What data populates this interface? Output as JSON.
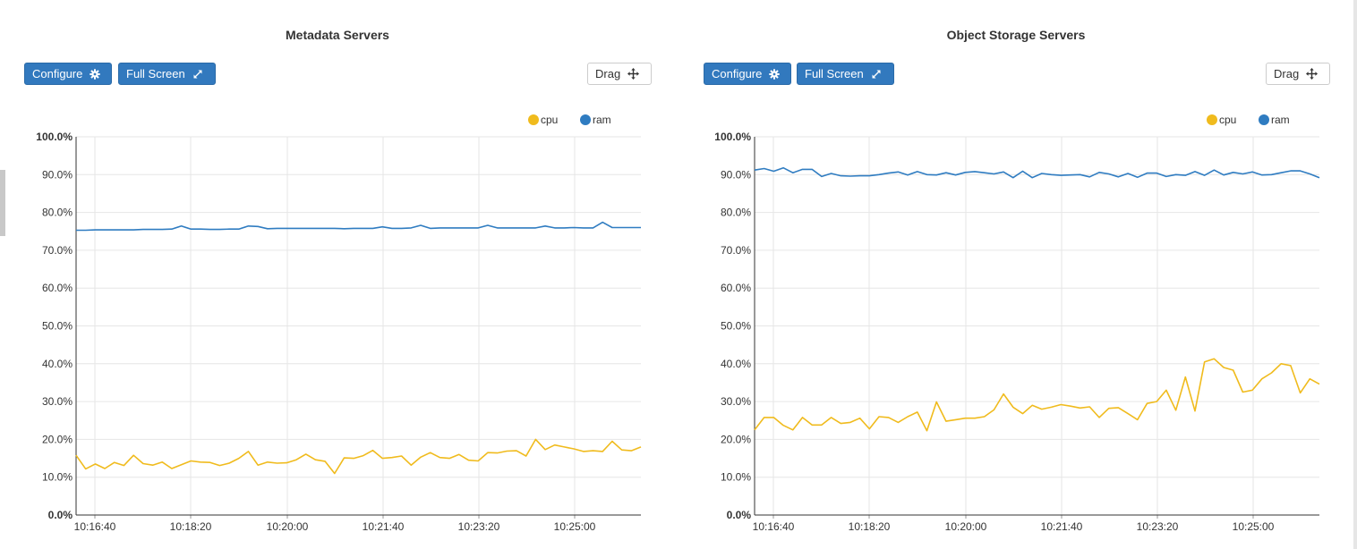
{
  "panels": [
    {
      "title": "Metadata Servers",
      "configure_label": "Configure",
      "fullscreen_label": "Full Screen",
      "drag_label": "Drag"
    },
    {
      "title": "Object Storage Servers",
      "configure_label": "Configure",
      "fullscreen_label": "Full Screen",
      "drag_label": "Drag"
    }
  ],
  "colors": {
    "cpu": "#f0bb1d",
    "ram": "#2f7cc1",
    "button": "#3279be"
  },
  "icons": {
    "configure": "gear-icon",
    "fullscreen": "expand-icon",
    "drag": "move-icon"
  },
  "chart_data": [
    {
      "type": "line",
      "title": "Metadata Servers",
      "x_ticks": [
        "10:16:40",
        "10:18:20",
        "10:20:00",
        "10:21:40",
        "10:23:20",
        "10:25:00"
      ],
      "y_ticks": [
        "0.0%",
        "10.0%",
        "20.0%",
        "30.0%",
        "40.0%",
        "50.0%",
        "60.0%",
        "70.0%",
        "80.0%",
        "90.0%",
        "100.0%"
      ],
      "ylim": [
        0,
        100
      ],
      "grid": true,
      "legend_position": "top-right",
      "series": [
        {
          "name": "cpu",
          "color": "#f0bb1d",
          "values": [
            15.8,
            12.2,
            13.5,
            12.3,
            13.9,
            13.1,
            15.8,
            13.6,
            13.2,
            14,
            12.3,
            13.3,
            14.3,
            14,
            13.9,
            13.1,
            13.7,
            15,
            16.8,
            13.2,
            14,
            13.7,
            13.8,
            14.6,
            16.1,
            14.6,
            14.2,
            11,
            15.1,
            15,
            15.7,
            17.1,
            15,
            15.2,
            15.6,
            13.2,
            15.3,
            16.5,
            15.2,
            15,
            16,
            14.5,
            14.3,
            16.5,
            16.4,
            16.9,
            17,
            15.6,
            20,
            17.3,
            18.5,
            18,
            17.5,
            16.8,
            17,
            16.8,
            19.5,
            17.2,
            17,
            18
          ]
        },
        {
          "name": "ram",
          "color": "#2f7cc1",
          "values": [
            75.3,
            75.3,
            75.4,
            75.4,
            75.4,
            75.4,
            75.4,
            75.5,
            75.5,
            75.5,
            75.6,
            76.4,
            75.6,
            75.6,
            75.5,
            75.5,
            75.6,
            75.6,
            76.4,
            76.3,
            75.7,
            75.8,
            75.8,
            75.8,
            75.8,
            75.8,
            75.8,
            75.8,
            75.7,
            75.8,
            75.8,
            75.8,
            76.2,
            75.8,
            75.8,
            75.9,
            76.6,
            75.8,
            75.9,
            75.9,
            75.9,
            75.9,
            75.9,
            76.6,
            75.9,
            75.9,
            75.9,
            75.9,
            75.9,
            76.4,
            75.9,
            75.9,
            76.0,
            75.9,
            75.9,
            77.4,
            76.0,
            76.0,
            76.0,
            76.0
          ]
        }
      ]
    },
    {
      "type": "line",
      "title": "Object Storage Servers",
      "x_ticks": [
        "10:16:40",
        "10:18:20",
        "10:20:00",
        "10:21:40",
        "10:23:20",
        "10:25:00"
      ],
      "y_ticks": [
        "0.0%",
        "10.0%",
        "20.0%",
        "30.0%",
        "40.0%",
        "50.0%",
        "60.0%",
        "70.0%",
        "80.0%",
        "90.0%",
        "100.0%"
      ],
      "ylim": [
        0,
        100
      ],
      "grid": true,
      "legend_position": "top-right",
      "series": [
        {
          "name": "cpu",
          "color": "#f0bb1d",
          "values": [
            22.5,
            25.8,
            25.8,
            23.7,
            22.5,
            25.8,
            23.8,
            23.8,
            25.8,
            24.2,
            24.5,
            25.6,
            22.8,
            26,
            25.8,
            24.5,
            26,
            27.2,
            22.3,
            29.9,
            24.8,
            25.2,
            25.6,
            25.6,
            26,
            27.8,
            32,
            28.5,
            26.8,
            29,
            28,
            28.5,
            29.2,
            28.8,
            28.3,
            28.6,
            25.8,
            28.2,
            28.4,
            26.8,
            25.2,
            29.5,
            30,
            33,
            27.7,
            36.5,
            27.5,
            40.5,
            41.3,
            39,
            38.3,
            32.5,
            33,
            36,
            37.6,
            40,
            39.5,
            32.3,
            36,
            34.6
          ]
        },
        {
          "name": "ram",
          "color": "#2f7cc1",
          "values": [
            91.2,
            91.6,
            90.9,
            91.8,
            90.5,
            91.4,
            91.4,
            89.5,
            90.3,
            89.7,
            89.6,
            89.7,
            89.7,
            90,
            90.4,
            90.7,
            89.9,
            90.8,
            90,
            89.9,
            90.5,
            89.9,
            90.6,
            90.8,
            90.5,
            90.2,
            90.7,
            89.2,
            90.9,
            89.2,
            90.3,
            90,
            89.8,
            89.9,
            90,
            89.4,
            90.6,
            90.2,
            89.4,
            90.3,
            89.3,
            90.4,
            90.4,
            89.5,
            90,
            89.8,
            90.8,
            89.8,
            91.2,
            89.9,
            90.6,
            90.2,
            90.7,
            89.9,
            90,
            90.5,
            91,
            91,
            90.2,
            89.2
          ]
        }
      ]
    }
  ]
}
